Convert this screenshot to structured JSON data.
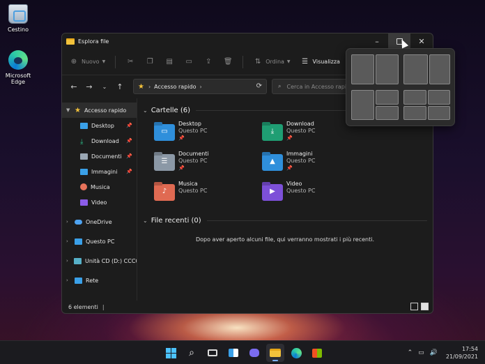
{
  "desktop": {
    "icons": [
      {
        "label": "Cestino"
      },
      {
        "label": "Microsoft Edge"
      }
    ]
  },
  "window": {
    "title": "Esplora file",
    "controls": {
      "minimize": "–",
      "close": "✕"
    }
  },
  "toolbar": {
    "new_label": "Nuovo",
    "sort_label": "Ordina",
    "view_label": "Visualizza"
  },
  "address": {
    "path_label": "Accesso rapido",
    "separator": "›",
    "search_placeholder": "Cerca in Accesso rapido"
  },
  "sidebar": {
    "items": [
      {
        "label": "Accesso rapido",
        "color": "#f3c23b"
      },
      {
        "label": "Desktop",
        "color": "#3aa0e8"
      },
      {
        "label": "Download",
        "color": "#2dbf8b"
      },
      {
        "label": "Documenti",
        "color": "#9aa7b4"
      },
      {
        "label": "Immagini",
        "color": "#3aa0e8"
      },
      {
        "label": "Musica",
        "color": "#e8735a"
      },
      {
        "label": "Video",
        "color": "#8b5ce8"
      },
      {
        "label": "OneDrive",
        "color": "#4ea3f0"
      },
      {
        "label": "Questo PC",
        "color": "#3aa0e8"
      },
      {
        "label": "Unità CD (D:) CCCO",
        "color": "#56b0c8"
      },
      {
        "label": "Rete",
        "color": "#3aa0e8"
      }
    ]
  },
  "content": {
    "folders_header": "Cartelle (6)",
    "recent_header": "File recenti (0)",
    "empty_message": "Dopo aver aperto alcuni file, qui verranno mostrati i più recenti.",
    "folders": [
      {
        "name": "Desktop",
        "location": "Questo PC",
        "color": "#2f8fdb"
      },
      {
        "name": "Download",
        "location": "Questo PC",
        "color": "#1f9e73"
      },
      {
        "name": "Documenti",
        "location": "Questo PC",
        "color": "#8b98a6"
      },
      {
        "name": "Immagini",
        "location": "Questo PC",
        "color": "#2f8fdb"
      },
      {
        "name": "Musica",
        "location": "Questo PC",
        "color": "#e06a52"
      },
      {
        "name": "Video",
        "location": "Questo PC",
        "color": "#7d50d8"
      }
    ]
  },
  "status": {
    "item_count": "6 elementi"
  },
  "taskbar": {
    "time": "17:54",
    "date": "21/09/2021"
  }
}
